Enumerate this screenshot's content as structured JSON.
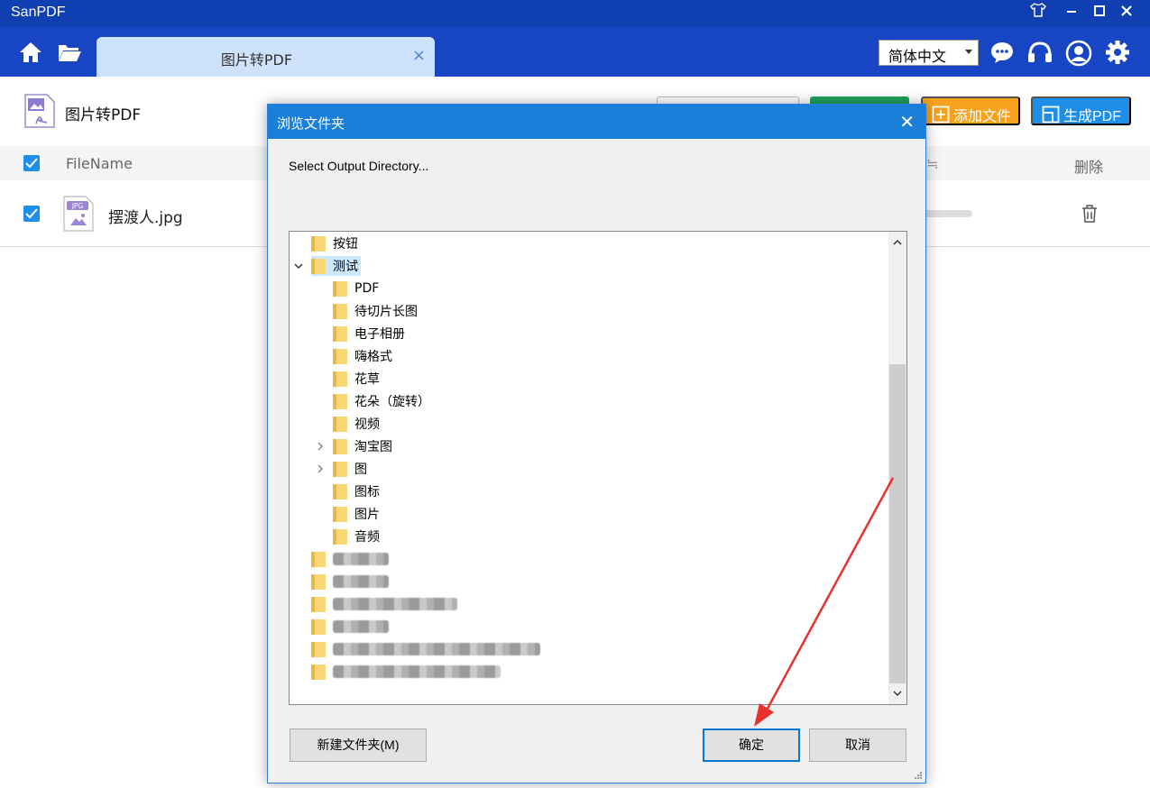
{
  "app": {
    "title": "SanPDF"
  },
  "window_controls": {
    "skin_icon": "tshirt-icon",
    "minimize_icon": "minimize-icon",
    "maximize_icon": "maximize-icon",
    "close_icon": "close-icon"
  },
  "nav": {
    "home_icon": "home-icon",
    "folder_icon": "folder-open-icon",
    "tab": {
      "label": "图片转PDF",
      "close": "×"
    },
    "language": {
      "selected": "简体中文"
    },
    "right_icons": [
      "chat-icon",
      "headset-icon",
      "user-icon",
      "gear-icon"
    ]
  },
  "page": {
    "title": "图片转PDF",
    "buttons": {
      "add_file": "添加文件",
      "generate_pdf": "生成PDF"
    }
  },
  "table": {
    "headers": {
      "filename": "FileName",
      "delete": "删除"
    },
    "rows": [
      {
        "name": "摆渡人.jpg",
        "checked": true,
        "file_icon": "jpg-file-icon"
      }
    ]
  },
  "dialog": {
    "title": "浏览文件夹",
    "close": "✕",
    "description": "Select Output Directory...",
    "tree": [
      {
        "label": "按钮",
        "level": 0
      },
      {
        "label": "测试",
        "level": 0,
        "expanded": true,
        "selected": true
      },
      {
        "label": "PDF",
        "level": 1
      },
      {
        "label": "待切片长图",
        "level": 1
      },
      {
        "label": "电子相册",
        "level": 1
      },
      {
        "label": "嗨格式",
        "level": 1
      },
      {
        "label": "花草",
        "level": 1
      },
      {
        "label": "花朵（旋转）",
        "level": 1
      },
      {
        "label": "视频",
        "level": 1
      },
      {
        "label": "淘宝图",
        "level": 1,
        "has_children": true
      },
      {
        "label": "图",
        "level": 1,
        "has_children": true
      },
      {
        "label": "图标",
        "level": 1
      },
      {
        "label": "图片",
        "level": 1
      },
      {
        "label": "音频",
        "level": 1
      }
    ],
    "buttons": {
      "new_folder": "新建文件夹(M)",
      "ok": "确定",
      "cancel": "取消"
    }
  },
  "colors": {
    "titlebar": "#0f3fb0",
    "navbar": "#1745c4",
    "tab": "#cfe2fb",
    "accent_blue": "#1e8ee8",
    "orange": "#f7a21c",
    "green": "#21a05c",
    "dialog_title": "#1a7fd8",
    "annotation_red": "#e8322f"
  }
}
